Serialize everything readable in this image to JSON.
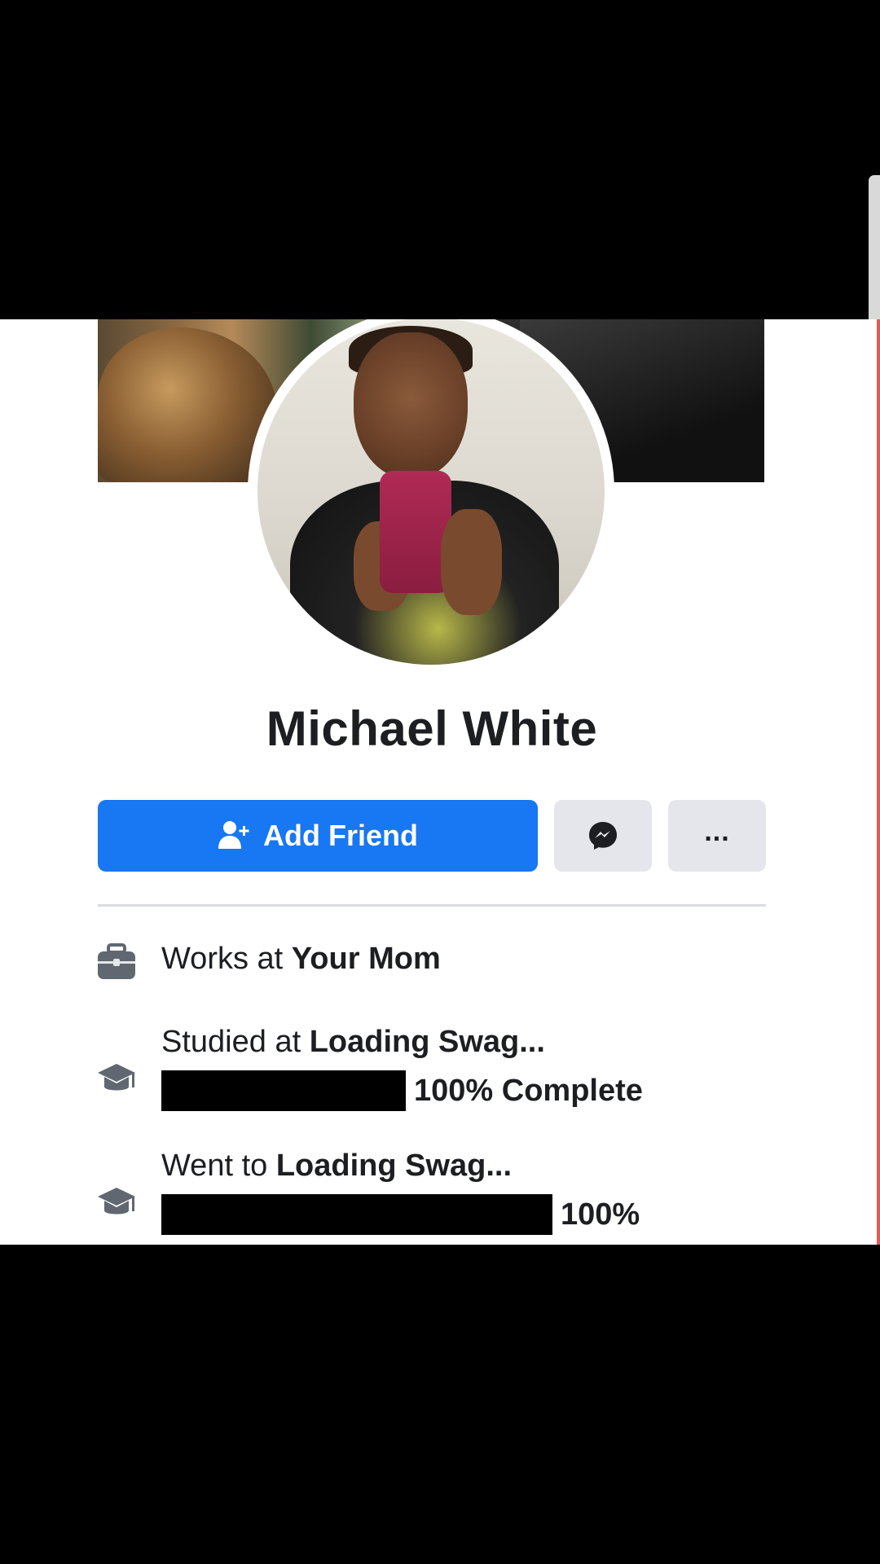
{
  "profile": {
    "name": "Michael White",
    "avatar_icon": "profile-photo",
    "cover_icon": "cover-photo"
  },
  "actions": {
    "add_friend_label": "Add Friend",
    "add_friend_icon": "add-friend-icon",
    "messenger_icon": "messenger-icon",
    "more_label": "...",
    "accent_color": "#1877f2",
    "secondary_button_color": "#e4e6eb"
  },
  "info": {
    "work": {
      "icon": "briefcase-icon",
      "prefix": "Works at ",
      "value": "Your Mom"
    },
    "study": {
      "icon": "graduation-cap-icon",
      "prefix": "Studied at ",
      "value": "Loading Swag...",
      "progress": 100,
      "progress_label": "100% Complete"
    },
    "went": {
      "icon": "graduation-cap-icon",
      "prefix": "Went to ",
      "value": "Loading Swag...",
      "progress": 100,
      "progress_label": "100%"
    }
  }
}
